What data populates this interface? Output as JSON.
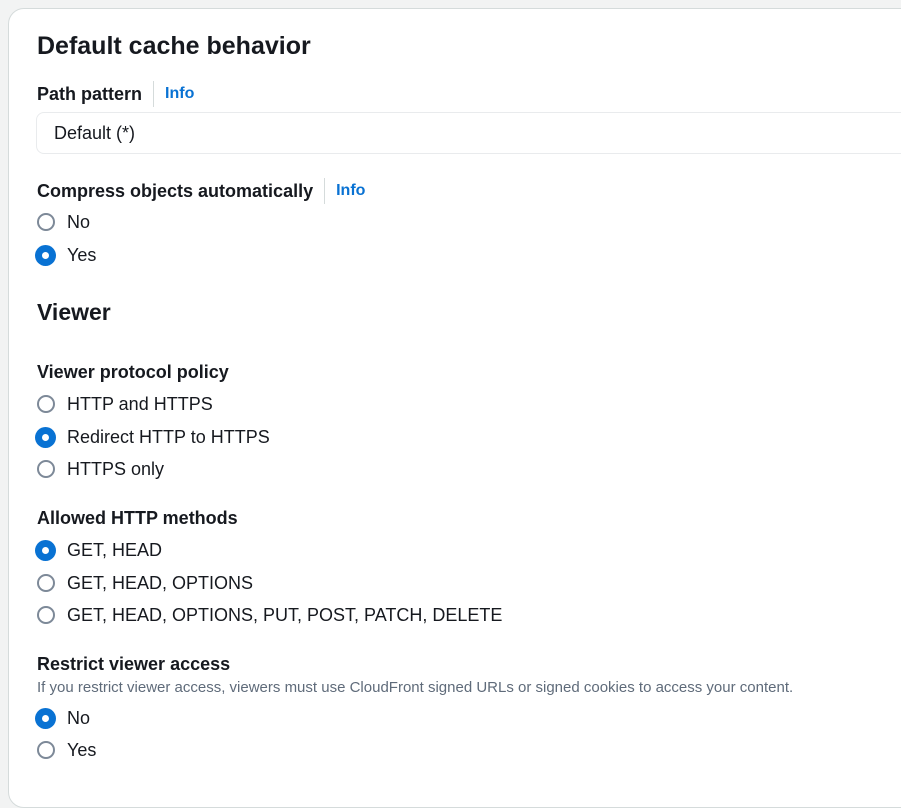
{
  "section": {
    "title": "Default cache behavior"
  },
  "path_pattern": {
    "label": "Path pattern",
    "info": "Info",
    "value": "Default (*)"
  },
  "compress": {
    "label": "Compress objects automatically",
    "info": "Info",
    "options": [
      {
        "label": "No",
        "checked": false
      },
      {
        "label": "Yes",
        "checked": true
      }
    ]
  },
  "viewer": {
    "title": "Viewer",
    "protocol_policy": {
      "label": "Viewer protocol policy",
      "options": [
        {
          "label": "HTTP and HTTPS",
          "checked": false
        },
        {
          "label": "Redirect HTTP to HTTPS",
          "checked": true
        },
        {
          "label": "HTTPS only",
          "checked": false
        }
      ]
    },
    "allowed_methods": {
      "label": "Allowed HTTP methods",
      "options": [
        {
          "label": "GET, HEAD",
          "checked": true
        },
        {
          "label": "GET, HEAD, OPTIONS",
          "checked": false
        },
        {
          "label": "GET, HEAD, OPTIONS, PUT, POST, PATCH, DELETE",
          "checked": false
        }
      ]
    },
    "restrict_access": {
      "label": "Restrict viewer access",
      "description": "If you restrict viewer access, viewers must use CloudFront signed URLs or signed cookies to access your content.",
      "options": [
        {
          "label": "No",
          "checked": true
        },
        {
          "label": "Yes",
          "checked": false
        }
      ]
    }
  },
  "colors": {
    "accent": "#0972d3",
    "text": "#16191f",
    "secondary_text": "#5f6b7a"
  }
}
